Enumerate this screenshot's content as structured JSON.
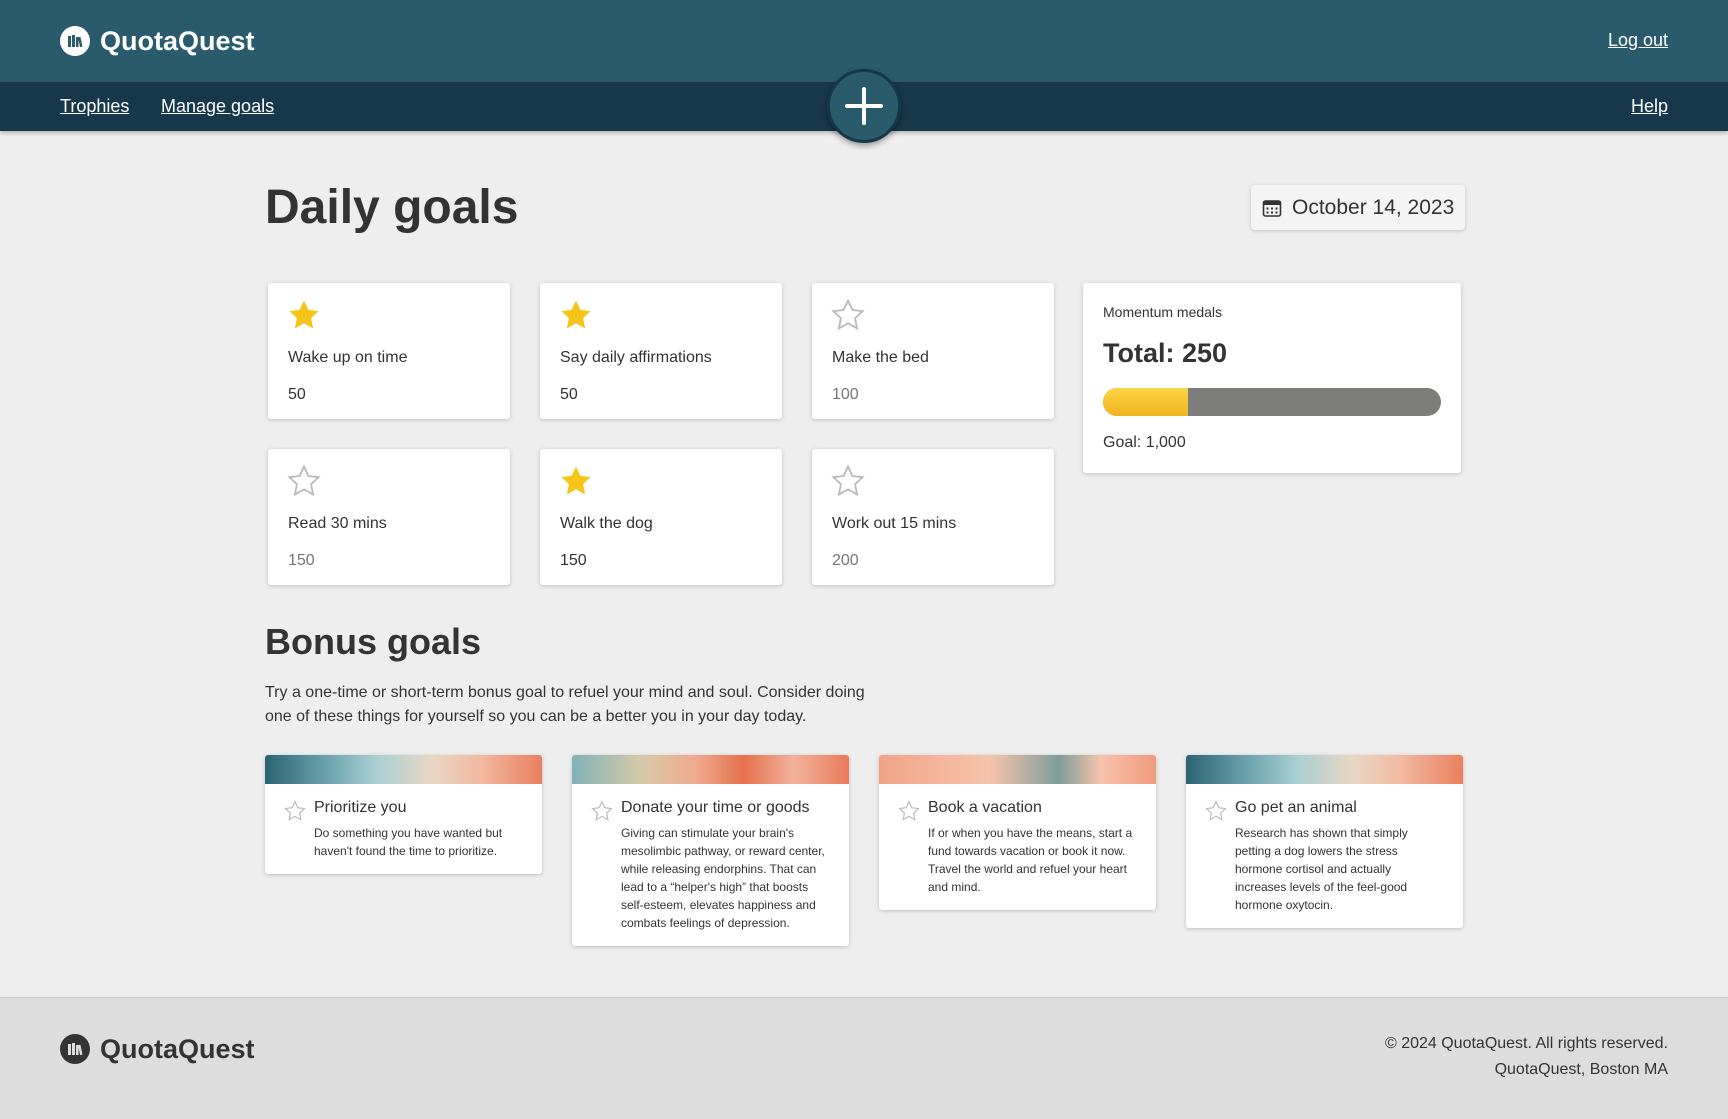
{
  "header": {
    "brand": "QuotaQuest",
    "logout_label": "Log out"
  },
  "nav": {
    "items": [
      {
        "label": "Trophies"
      },
      {
        "label": "Manage goals"
      }
    ],
    "help_label": "Help",
    "add_icon": "plus-icon"
  },
  "main": {
    "title": "Daily goals",
    "date": "October 14, 2023",
    "date_icon": "calendar-icon"
  },
  "daily_goals": [
    {
      "label": "Wake up on time",
      "points": "50",
      "completed": true
    },
    {
      "label": "Say daily affirmations",
      "points": "50",
      "completed": true
    },
    {
      "label": "Make the bed",
      "points": "100",
      "completed": false
    },
    {
      "label": "Read 30 mins",
      "points": "150",
      "completed": false
    },
    {
      "label": "Walk the dog",
      "points": "150",
      "completed": true
    },
    {
      "label": "Work out 15 mins",
      "points": "200",
      "completed": false
    }
  ],
  "momentum": {
    "title": "Momentum medals",
    "total_label": "Total: 250",
    "goal_label": "Goal: 1,000",
    "progress": 0.25
  },
  "bonus": {
    "title": "Bonus goals",
    "description": "Try a one-time or short-term bonus goal to refuel your mind and soul. Consider doing one of these things for yourself so you can be a better you in your day today.",
    "cards": [
      {
        "title": "Prioritize you",
        "text": "Do something you have wanted but haven't found the time to prioritize."
      },
      {
        "title": "Donate your time or goods",
        "text": "Giving can stimulate your brain's mesolimbic pathway, or reward center, while releasing endorphins. That can lead to a “helper's high” that boosts self-esteem, elevates happiness and combats feelings of depression."
      },
      {
        "title": "Book a vacation",
        "text": "If or when you have the means, start a fund towards vacation or book it now. Travel the world and refuel your heart and mind."
      },
      {
        "title": "Go pet an animal",
        "text": "Research has shown that simply petting a dog lowers the stress hormone cortisol and actually increases levels of the feel-good hormone oxytocin."
      }
    ]
  },
  "footer": {
    "brand": "QuotaQuest",
    "copyright": "© 2024 QuotaQuest. All rights reserved.",
    "location": "QuotaQuest, Boston MA"
  },
  "colors": {
    "header": "#2a5b6c",
    "nav": "#17374a",
    "star_filled": "#f5c518",
    "star_empty": "#bbbbbb",
    "progress_fill": "#f5c12e",
    "progress_track": "#7d7d7b"
  }
}
